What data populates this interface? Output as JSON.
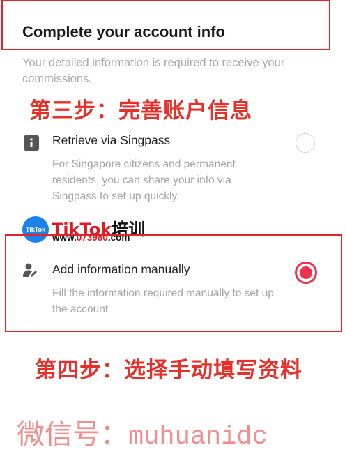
{
  "header": {
    "title": "Complete your account info",
    "subtitle": "Your detailed information is required to receive your commissions."
  },
  "annotations": {
    "step3": "第三步：完善账户信息",
    "step4": "第四步：选择手动填写资料"
  },
  "options": [
    {
      "title": "Retrieve via Singpass",
      "description": "For Singapore citizens and permanent residents, you can share your info via Singpass to set up quickly",
      "icon": "info-icon",
      "selected": false
    },
    {
      "title": "Add information manually",
      "description": "Fill the information required manually to set up the account",
      "icon": "user-edit-icon",
      "selected": true
    }
  ],
  "watermark": {
    "badge": "TikTok",
    "brand": "TikTok",
    "brand_suffix": "培训",
    "url_prefix": "www.",
    "url_number": "073980",
    "url_suffix": ".com",
    "wechat_label": "微信号：",
    "wechat_id": "muhuanidc"
  },
  "colors": {
    "accent": "#f0314e",
    "annotation_red": "#e8302a",
    "box_border": "#e0242a"
  }
}
